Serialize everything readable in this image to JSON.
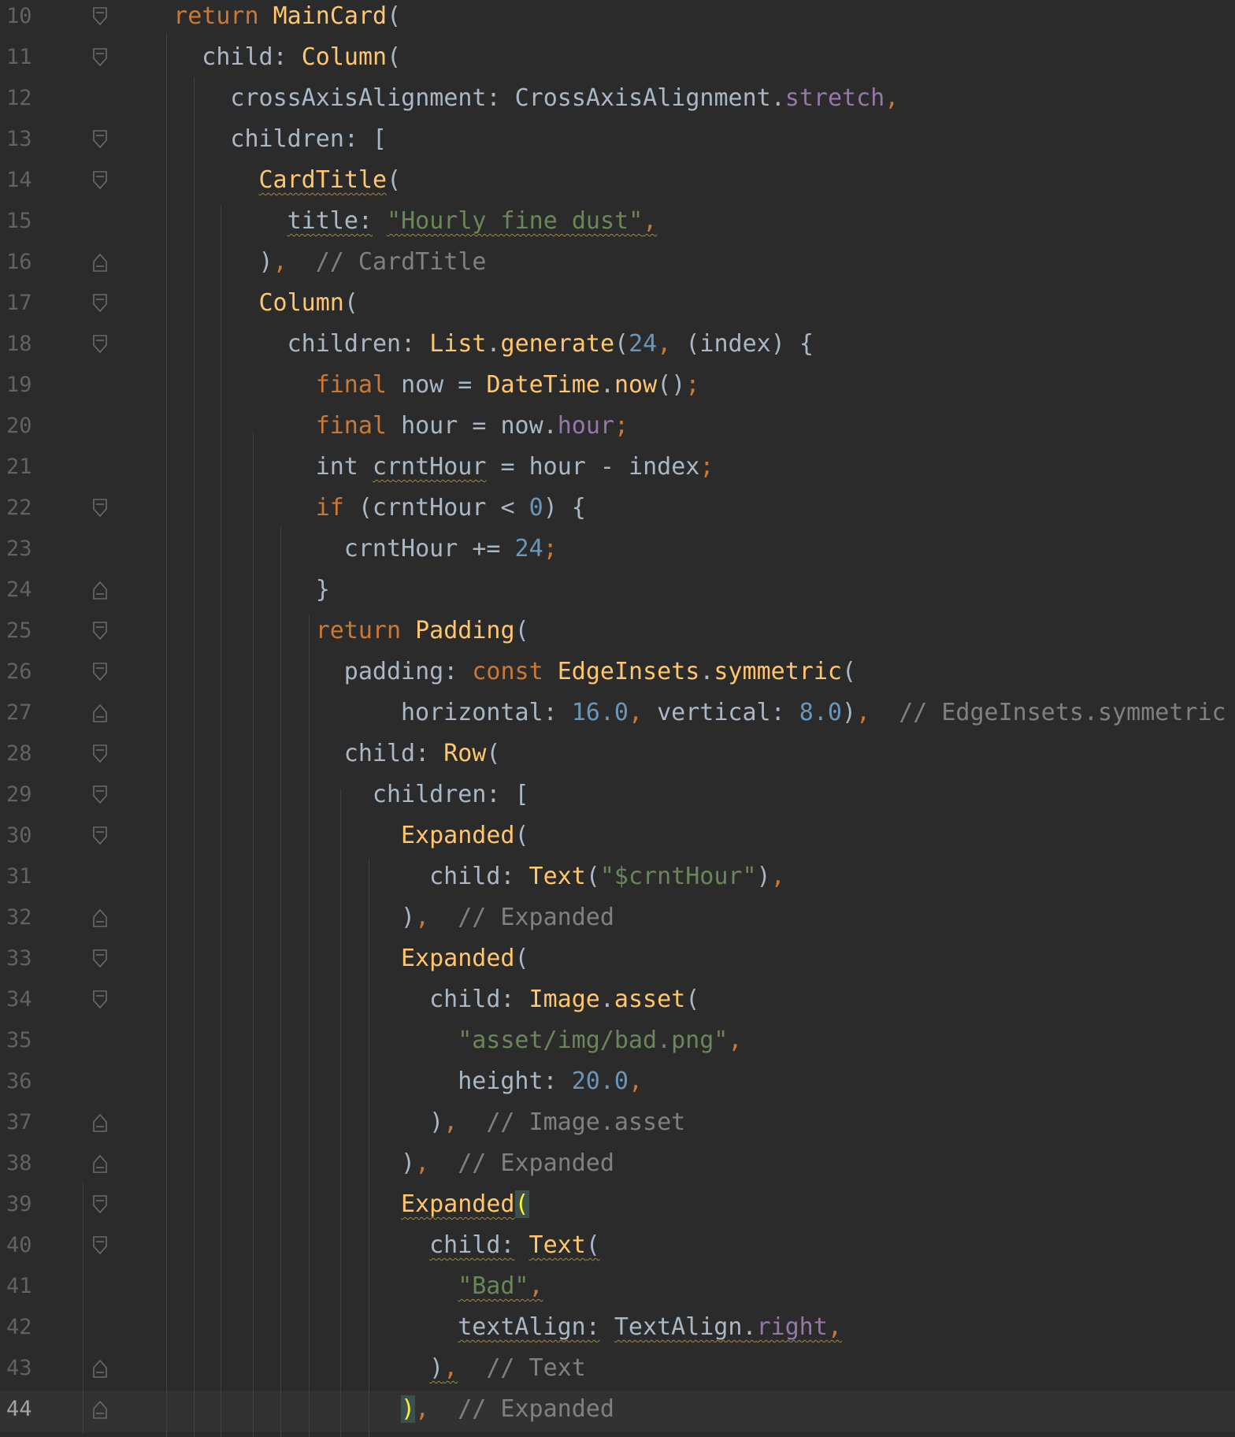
{
  "editor": {
    "language": "Dart",
    "current_line": 44,
    "colors": {
      "background": "#2b2b2b",
      "keyword": "#cc7832",
      "function": "#ffc66d",
      "string": "#6a8759",
      "number": "#6897bb",
      "property": "#9876aa",
      "comment": "#808080",
      "default": "#a9b7c6",
      "line_number": "#606366"
    },
    "lines": [
      {
        "num": "10",
        "fold": "open"
      },
      {
        "num": "11",
        "fold": "open"
      },
      {
        "num": "12",
        "fold": ""
      },
      {
        "num": "13",
        "fold": "open"
      },
      {
        "num": "14",
        "fold": "open"
      },
      {
        "num": "15",
        "fold": ""
      },
      {
        "num": "16",
        "fold": "close"
      },
      {
        "num": "17",
        "fold": "open"
      },
      {
        "num": "18",
        "fold": "open"
      },
      {
        "num": "19",
        "fold": ""
      },
      {
        "num": "20",
        "fold": ""
      },
      {
        "num": "21",
        "fold": ""
      },
      {
        "num": "22",
        "fold": "open"
      },
      {
        "num": "23",
        "fold": ""
      },
      {
        "num": "24",
        "fold": "close"
      },
      {
        "num": "25",
        "fold": "open"
      },
      {
        "num": "26",
        "fold": "open"
      },
      {
        "num": "27",
        "fold": "close"
      },
      {
        "num": "28",
        "fold": "open"
      },
      {
        "num": "29",
        "fold": "open"
      },
      {
        "num": "30",
        "fold": "open"
      },
      {
        "num": "31",
        "fold": ""
      },
      {
        "num": "32",
        "fold": "close"
      },
      {
        "num": "33",
        "fold": "open"
      },
      {
        "num": "34",
        "fold": "open"
      },
      {
        "num": "35",
        "fold": ""
      },
      {
        "num": "36",
        "fold": ""
      },
      {
        "num": "37",
        "fold": "close"
      },
      {
        "num": "38",
        "fold": "close"
      },
      {
        "num": "39",
        "fold": "open"
      },
      {
        "num": "40",
        "fold": "open"
      },
      {
        "num": "41",
        "fold": ""
      },
      {
        "num": "42",
        "fold": ""
      },
      {
        "num": "43",
        "fold": "close"
      },
      {
        "num": "44",
        "fold": "close"
      }
    ],
    "tokens": {
      "l10": [
        "return",
        "MainCard",
        "("
      ],
      "l11": [
        "child:",
        "Column",
        "("
      ],
      "l12": [
        "crossAxisAlignment:",
        "CrossAxisAlignment",
        ".",
        "stretch",
        ","
      ],
      "l13": [
        "children:",
        "["
      ],
      "l14": [
        "CardTitle",
        "("
      ],
      "l15": [
        "title:",
        "\"Hourly fine dust\"",
        ","
      ],
      "l16": [
        ")",
        ",",
        "// CardTitle"
      ],
      "l17": [
        "Column",
        "("
      ],
      "l18": [
        "children:",
        "List",
        ".",
        "generate",
        "(",
        "24",
        ",",
        "(index) {"
      ],
      "l19": [
        "final",
        "now = ",
        "DateTime",
        ".",
        "now",
        "()",
        ";"
      ],
      "l20": [
        "final",
        "hour = now.",
        "hour",
        ";"
      ],
      "l21": [
        "int ",
        "crntHour",
        " = hour - index",
        ";"
      ],
      "l22": [
        "if",
        " (crntHour < ",
        "0",
        ") {"
      ],
      "l23": [
        "crntHour += ",
        "24",
        ";"
      ],
      "l24": [
        "}"
      ],
      "l25": [
        "return",
        "Padding",
        "("
      ],
      "l26": [
        "padding:",
        "const",
        "EdgeInsets",
        ".",
        "symmetric",
        "("
      ],
      "l27": [
        "horizontal:",
        "16.0",
        ",",
        "vertical:",
        "8.0",
        ")",
        ",",
        "// EdgeInsets.symmetric"
      ],
      "l28": [
        "child:",
        "Row",
        "("
      ],
      "l29": [
        "children:",
        "["
      ],
      "l30": [
        "Expanded",
        "("
      ],
      "l31": [
        "child:",
        "Text",
        "(",
        "\"$crntHour\"",
        ")",
        ","
      ],
      "l32": [
        ")",
        ",",
        "// Expanded"
      ],
      "l33": [
        "Expanded",
        "("
      ],
      "l34": [
        "child:",
        "Image",
        ".",
        "asset",
        "("
      ],
      "l35": [
        "\"asset/img/bad.png\"",
        ","
      ],
      "l36": [
        "height:",
        "20.0",
        ","
      ],
      "l37": [
        ")",
        ",",
        "// Image.asset"
      ],
      "l38": [
        ")",
        ",",
        "// Expanded"
      ],
      "l39": [
        "Expanded",
        "("
      ],
      "l40": [
        "child:",
        "Text",
        "("
      ],
      "l41": [
        "\"Bad\"",
        ","
      ],
      "l42": [
        "textAlign:",
        "TextAlign",
        ".",
        "right",
        ","
      ],
      "l43": [
        ")",
        ",",
        "// Text"
      ],
      "l44": [
        ")",
        ",",
        "// Expanded"
      ]
    }
  }
}
